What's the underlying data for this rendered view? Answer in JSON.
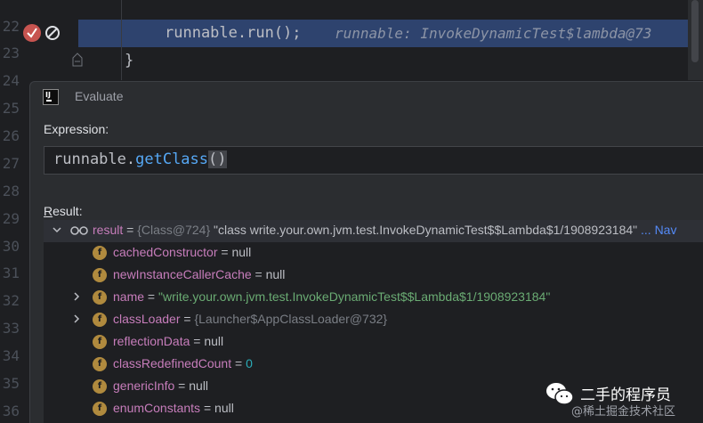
{
  "editor": {
    "line_numbers": [
      "22",
      "23",
      "24",
      "25",
      "26",
      "27",
      "28",
      "29",
      "30",
      "31",
      "32",
      "33",
      "34",
      "35",
      "36"
    ],
    "code_line_22": "runnable.run();",
    "inline_hint_22": "runnable: InvokeDynamicTest$lambda@73",
    "code_line_23": "}"
  },
  "dialog": {
    "title": "Evaluate",
    "expression_label": "Expression:",
    "expression": {
      "object": "runnable.",
      "method": "getClass",
      "parens": "()"
    },
    "result_label_first": "R",
    "result_label_rest": "esult:"
  },
  "result": {
    "name": "result",
    "eq": " = ",
    "ref": "{Class@724}",
    "value": "\"class write.your.own.jvm.test.InvokeDynamicTest$$Lambda$1/1908923184\"",
    "nav": "... Nav",
    "fields": [
      {
        "name": "cachedConstructor",
        "eq": " = ",
        "value": "null",
        "kind": "null",
        "expandable": false
      },
      {
        "name": "newInstanceCallerCache",
        "eq": " = ",
        "value": "null",
        "kind": "null",
        "expandable": false
      },
      {
        "name": "name",
        "eq": " = ",
        "value": "\"write.your.own.jvm.test.InvokeDynamicTest$$Lambda$1/1908923184\"",
        "kind": "str",
        "expandable": true
      },
      {
        "name": "classLoader",
        "eq": " = ",
        "value": "{Launcher$AppClassLoader@732}",
        "kind": "ref",
        "expandable": true
      },
      {
        "name": "reflectionData",
        "eq": " = ",
        "value": "null",
        "kind": "null",
        "expandable": false
      },
      {
        "name": "classRedefinedCount",
        "eq": " = ",
        "value": "0",
        "kind": "num",
        "expandable": false
      },
      {
        "name": "genericInfo",
        "eq": " = ",
        "value": "null",
        "kind": "null",
        "expandable": false
      },
      {
        "name": "enumConstants",
        "eq": " = ",
        "value": "null",
        "kind": "null",
        "expandable": false
      }
    ],
    "field_icon_letter": "f"
  },
  "watermark": {
    "name": "二手的程序员",
    "sub": "@稀土掘金技术社区"
  },
  "icons": {
    "breakpoint": "breakpoint-icon",
    "mute": "mute-breakpoints-icon",
    "fold": "fold-icon",
    "app": "intellij-logo-icon",
    "watch": "watch-glasses-icon",
    "field": "field-icon",
    "chevron_right": "chevron-right-icon",
    "chevron_down": "chevron-down-icon"
  },
  "colors": {
    "highlight_line": "#2e436e",
    "field_name": "#c77dbb",
    "string_value": "#6aab73",
    "number_value": "#2aacb8",
    "method_call": "#56a8f5"
  }
}
